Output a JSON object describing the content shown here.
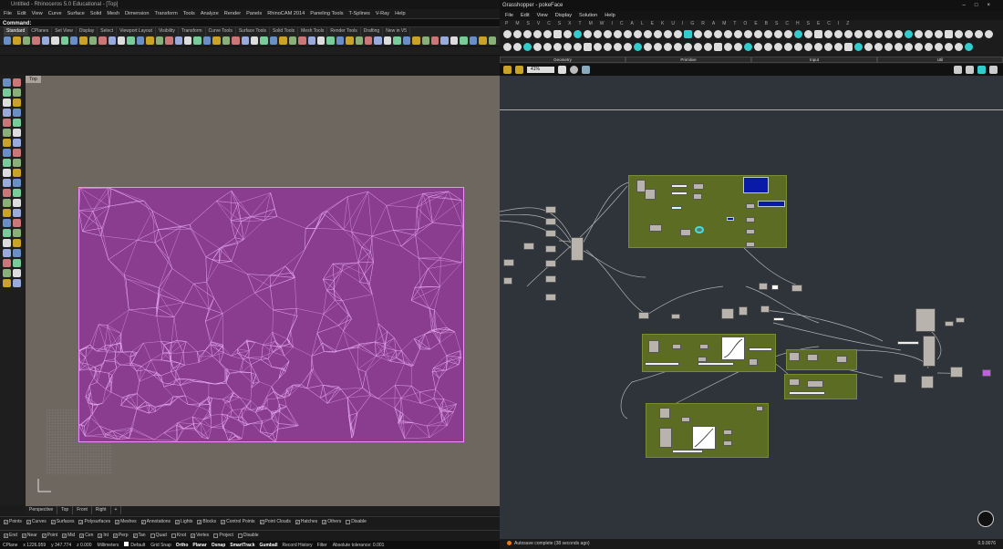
{
  "rhino": {
    "title": "Untitled - Rhinoceros 5.0 Educational - [Top]",
    "menu": [
      "File",
      "Edit",
      "View",
      "Curve",
      "Surface",
      "Solid",
      "Mesh",
      "Dimension",
      "Transform",
      "Tools",
      "Analyze",
      "Render",
      "Panels",
      "RhinoCAM 2014",
      "Paneling Tools",
      "T-Splines",
      "V-Ray",
      "Help"
    ],
    "command_label": "Command:",
    "toolbar_tabs": [
      "Standard",
      "CPlanes",
      "Set View",
      "Display",
      "Select",
      "Viewport Layout",
      "Visibility",
      "Transform",
      "Curve Tools",
      "Surface Tools",
      "Solid Tools",
      "Mesh Tools",
      "Render Tools",
      "Drafting",
      "New in V5"
    ],
    "viewport_label": "Top",
    "view_tabs": [
      "Perspective",
      "Top",
      "Front",
      "Right",
      "+"
    ],
    "object_filters": [
      {
        "label": "Points",
        "checked": true
      },
      {
        "label": "Curves",
        "checked": true
      },
      {
        "label": "Surfaces",
        "checked": true
      },
      {
        "label": "Polysurfaces",
        "checked": true
      },
      {
        "label": "Meshes",
        "checked": true
      },
      {
        "label": "Annotations",
        "checked": true
      },
      {
        "label": "Lights",
        "checked": true
      },
      {
        "label": "Blocks",
        "checked": true
      },
      {
        "label": "Control Points",
        "checked": true
      },
      {
        "label": "Point Clouds",
        "checked": true
      },
      {
        "label": "Hatches",
        "checked": true
      },
      {
        "label": "Others",
        "checked": true
      },
      {
        "label": "Disable",
        "checked": false
      }
    ],
    "osnaps": [
      {
        "label": "End",
        "checked": true
      },
      {
        "label": "Near",
        "checked": true
      },
      {
        "label": "Point",
        "checked": true
      },
      {
        "label": "Mid",
        "checked": true
      },
      {
        "label": "Cen",
        "checked": true
      },
      {
        "label": "Int",
        "checked": true
      },
      {
        "label": "Perp",
        "checked": true
      },
      {
        "label": "Tan",
        "checked": true
      },
      {
        "label": "Quad",
        "checked": false
      },
      {
        "label": "Knot",
        "checked": false
      },
      {
        "label": "Vertex",
        "checked": true
      },
      {
        "label": "Project",
        "checked": false
      },
      {
        "label": "Disable",
        "checked": false
      }
    ],
    "status": {
      "cplane": "CPlane",
      "x": "x 1226.959",
      "y": "y 347.774",
      "z": "z 0.000",
      "units": "Millimeters",
      "layer": "Default",
      "toggles": [
        "Grid Snap",
        "Ortho",
        "Planar",
        "Osnap",
        "SmartTrack",
        "Gumball",
        "Record History",
        "Filter"
      ],
      "tolerance": "Absolute tolerance: 0.001"
    },
    "mesh_color": "#c75ad6"
  },
  "gh": {
    "title": "Grasshopper - pokeFace",
    "menu": [
      "File",
      "Edit",
      "View",
      "Display",
      "Solution",
      "Help"
    ],
    "categories": [
      "P",
      "M",
      "S",
      "V",
      "C",
      "S",
      "X",
      "T",
      "M",
      "W",
      "I",
      "C",
      "A",
      "L",
      "E",
      "K",
      "U",
      "I",
      "G",
      "R",
      "A",
      "M",
      "T",
      "O",
      "E",
      "B",
      "S",
      "C",
      "H",
      "S",
      "E",
      "C",
      "I",
      "Z"
    ],
    "panels": [
      "Geometry",
      "Primitive",
      "Input",
      "Util"
    ],
    "zoom": "41%",
    "status": "Autosave complete (38 seconds ago)",
    "version": "0.9.0076"
  }
}
